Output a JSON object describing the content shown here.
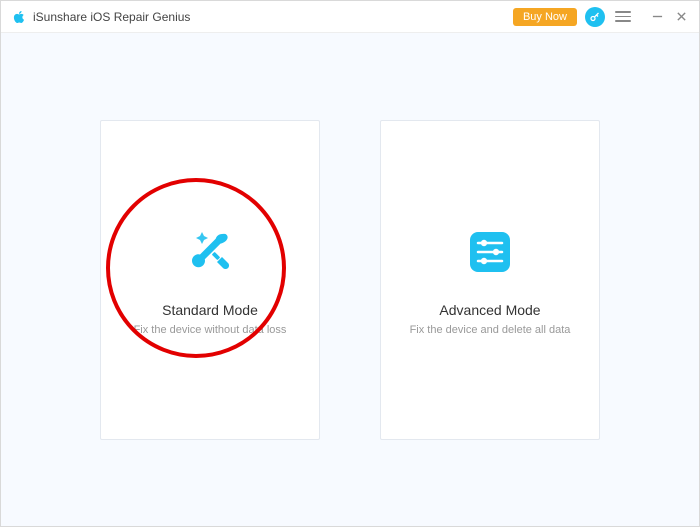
{
  "titlebar": {
    "app_title": "iSunshare iOS Repair Genius",
    "buy_now": "Buy Now"
  },
  "cards": {
    "standard": {
      "title": "Standard Mode",
      "desc": "Fix the device without data loss"
    },
    "advanced": {
      "title": "Advanced Mode",
      "desc": "Fix the device and delete all data"
    }
  },
  "colors": {
    "accent": "#1fc0f0",
    "buy": "#f5a623",
    "annotation": "#e20000"
  }
}
